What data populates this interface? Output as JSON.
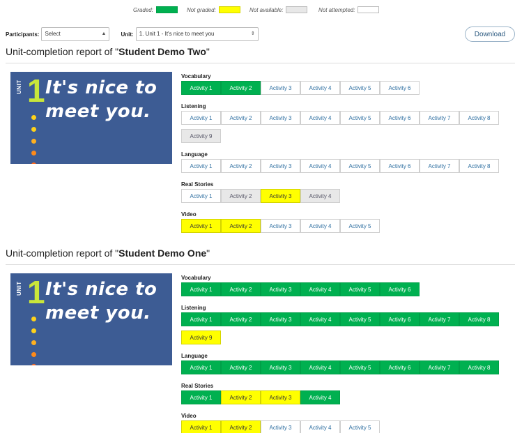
{
  "legend": {
    "graded_label": "Graded:",
    "not_graded_label": "Not graded:",
    "not_available_label": "Not available:",
    "not_attempted_label": "Not attempted:",
    "colors": {
      "graded": "#00b050",
      "not_graded": "#ffff00",
      "not_available": "#e8e8e8",
      "not_attempted": "#ffffff"
    }
  },
  "filters": {
    "participants_label": "Participants:",
    "participants_value": "Select",
    "unit_label": "Unit:",
    "unit_value": "1. Unit 1 - It's nice to meet you"
  },
  "download_label": "Download",
  "banner": {
    "unit_word": "UNIT",
    "unit_number": "1",
    "tagline_line1": "It's nice to",
    "tagline_line2": "meet you.",
    "dot_colors": [
      "#ffd21a",
      "#ffd21a",
      "#ffb020",
      "#ff8a1a",
      "#ff6a20"
    ]
  },
  "reports": [
    {
      "title_prefix": "Unit-completion report of \"",
      "student": "Student Demo Two",
      "title_suffix": "\"",
      "sections": [
        {
          "name": "Vocabulary",
          "activities": [
            {
              "label": "Activity 1",
              "status": "g"
            },
            {
              "label": "Activity 2",
              "status": "g"
            },
            {
              "label": "Activity 3",
              "status": "w"
            },
            {
              "label": "Activity 4",
              "status": "w"
            },
            {
              "label": "Activity 5",
              "status": "w"
            },
            {
              "label": "Activity 6",
              "status": "w"
            }
          ]
        },
        {
          "name": "Listening",
          "activities": [
            {
              "label": "Activity 1",
              "status": "w"
            },
            {
              "label": "Activity 2",
              "status": "w"
            },
            {
              "label": "Activity 3",
              "status": "w"
            },
            {
              "label": "Activity 4",
              "status": "w"
            },
            {
              "label": "Activity 5",
              "status": "w"
            },
            {
              "label": "Activity 6",
              "status": "w"
            },
            {
              "label": "Activity 7",
              "status": "w"
            },
            {
              "label": "Activity 8",
              "status": "w"
            },
            {
              "label": "Activity 9",
              "status": "n"
            }
          ]
        },
        {
          "name": "Language",
          "activities": [
            {
              "label": "Activity 1",
              "status": "w"
            },
            {
              "label": "Activity 2",
              "status": "w"
            },
            {
              "label": "Activity 3",
              "status": "w"
            },
            {
              "label": "Activity 4",
              "status": "w"
            },
            {
              "label": "Activity 5",
              "status": "w"
            },
            {
              "label": "Activity 6",
              "status": "w"
            },
            {
              "label": "Activity 7",
              "status": "w"
            },
            {
              "label": "Activity 8",
              "status": "w"
            }
          ]
        },
        {
          "name": "Real Stories",
          "activities": [
            {
              "label": "Activity 1",
              "status": "w"
            },
            {
              "label": "Activity 2",
              "status": "n"
            },
            {
              "label": "Activity 3",
              "status": "y"
            },
            {
              "label": "Activity 4",
              "status": "n"
            }
          ]
        },
        {
          "name": "Video",
          "activities": [
            {
              "label": "Activity 1",
              "status": "y"
            },
            {
              "label": "Activity 2",
              "status": "y"
            },
            {
              "label": "Activity 3",
              "status": "w"
            },
            {
              "label": "Activity 4",
              "status": "w"
            },
            {
              "label": "Activity 5",
              "status": "w"
            }
          ]
        }
      ]
    },
    {
      "title_prefix": "Unit-completion report of \"",
      "student": "Student Demo One",
      "title_suffix": "\"",
      "sections": [
        {
          "name": "Vocabulary",
          "activities": [
            {
              "label": "Activity 1",
              "status": "g"
            },
            {
              "label": "Activity 2",
              "status": "g"
            },
            {
              "label": "Activity 3",
              "status": "g"
            },
            {
              "label": "Activity 4",
              "status": "g"
            },
            {
              "label": "Activity 5",
              "status": "g"
            },
            {
              "label": "Activity 6",
              "status": "g"
            }
          ]
        },
        {
          "name": "Listening",
          "activities": [
            {
              "label": "Activity 1",
              "status": "g"
            },
            {
              "label": "Activity 2",
              "status": "g"
            },
            {
              "label": "Activity 3",
              "status": "g"
            },
            {
              "label": "Activity 4",
              "status": "g"
            },
            {
              "label": "Activity 5",
              "status": "g"
            },
            {
              "label": "Activity 6",
              "status": "g"
            },
            {
              "label": "Activity 7",
              "status": "g"
            },
            {
              "label": "Activity 8",
              "status": "g"
            },
            {
              "label": "Activity 9",
              "status": "y"
            }
          ]
        },
        {
          "name": "Language",
          "activities": [
            {
              "label": "Activity 1",
              "status": "g"
            },
            {
              "label": "Activity 2",
              "status": "g"
            },
            {
              "label": "Activity 3",
              "status": "g"
            },
            {
              "label": "Activity 4",
              "status": "g"
            },
            {
              "label": "Activity 5",
              "status": "g"
            },
            {
              "label": "Activity 6",
              "status": "g"
            },
            {
              "label": "Activity 7",
              "status": "g"
            },
            {
              "label": "Activity 8",
              "status": "g"
            }
          ]
        },
        {
          "name": "Real Stories",
          "activities": [
            {
              "label": "Activity 1",
              "status": "g"
            },
            {
              "label": "Activity 2",
              "status": "y"
            },
            {
              "label": "Activity 3",
              "status": "y"
            },
            {
              "label": "Activity 4",
              "status": "g"
            }
          ]
        },
        {
          "name": "Video",
          "activities": [
            {
              "label": "Activity 1",
              "status": "y"
            },
            {
              "label": "Activity 2",
              "status": "y"
            },
            {
              "label": "Activity 3",
              "status": "w"
            },
            {
              "label": "Activity 4",
              "status": "w"
            },
            {
              "label": "Activity 5",
              "status": "w"
            }
          ]
        }
      ]
    }
  ]
}
